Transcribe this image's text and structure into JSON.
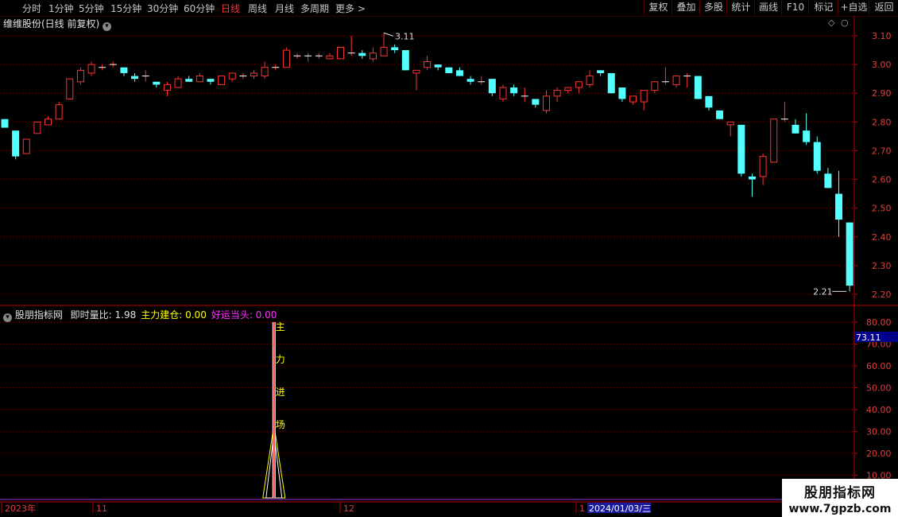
{
  "toolbar": {
    "periods": [
      "分时",
      "1分钟",
      "5分钟",
      "15分钟",
      "30分钟",
      "60分钟",
      "日线",
      "周线",
      "月线",
      "多周期",
      "更多"
    ],
    "active_period": "日线",
    "right_buttons": [
      "复权",
      "叠加",
      "多股",
      "统计",
      "画线",
      "F10",
      "标记",
      "+自选",
      "返回"
    ]
  },
  "main_chart": {
    "title": "维维股份(日线 前复权)",
    "high_annotation": "3.11",
    "low_annotation": "2.21"
  },
  "indicator": {
    "name": "股朋指标网",
    "items": [
      {
        "label": "即时量比:",
        "value": "1.98",
        "color": "#e0e0e0"
      },
      {
        "label": "主力建仓:",
        "value": "0.00",
        "color": "#ffff00"
      },
      {
        "label": "好运当头:",
        "value": "0.00",
        "color": "#ff33ff"
      }
    ],
    "marker_chars": [
      "主",
      "力",
      "进",
      "场"
    ],
    "current_value": "73.11"
  },
  "timeline": {
    "labels": [
      "2023年",
      "11",
      "12",
      "1"
    ],
    "cursor_date": "2024/01/03/三"
  },
  "watermark": {
    "line1": "股朋指标网",
    "line2": "www.7gpzb.com"
  },
  "colors": {
    "up": "#ff3232",
    "down": "#54ffff",
    "grid": "#800000",
    "axis": "#c00000"
  },
  "chart_data": {
    "type": "candlestick",
    "title": "维维股份(日线 前复权)",
    "y_axis": {
      "range": [
        2.18,
        3.12
      ],
      "ticks": [
        3.1,
        3.0,
        2.9,
        2.8,
        2.7,
        2.6,
        2.5,
        2.4,
        2.3,
        2.2
      ]
    },
    "indicator_axis": {
      "range": [
        0,
        80
      ],
      "ticks": [
        80,
        70,
        60,
        50,
        40,
        30,
        20,
        10
      ]
    },
    "ohlc": [
      [
        2.81,
        2.81,
        2.78,
        2.78
      ],
      [
        2.77,
        2.77,
        2.67,
        2.68
      ],
      [
        2.69,
        2.74,
        2.69,
        2.74
      ],
      [
        2.76,
        2.8,
        2.76,
        2.8
      ],
      [
        2.79,
        2.82,
        2.79,
        2.81
      ],
      [
        2.81,
        2.87,
        2.81,
        2.86
      ],
      [
        2.88,
        2.95,
        2.88,
        2.95
      ],
      [
        2.94,
        2.99,
        2.93,
        2.98
      ],
      [
        2.97,
        3.01,
        2.96,
        3.0
      ],
      [
        2.99,
        3.0,
        2.98,
        2.99
      ],
      [
        3.0,
        3.01,
        2.99,
        3.0
      ],
      [
        2.99,
        2.99,
        2.96,
        2.97
      ],
      [
        2.96,
        2.97,
        2.94,
        2.95
      ],
      [
        2.96,
        2.98,
        2.94,
        2.96
      ],
      [
        2.94,
        2.94,
        2.92,
        2.93
      ],
      [
        2.91,
        2.94,
        2.89,
        2.93
      ],
      [
        2.92,
        2.96,
        2.92,
        2.95
      ],
      [
        2.95,
        2.96,
        2.94,
        2.94
      ],
      [
        2.94,
        2.97,
        2.94,
        2.96
      ],
      [
        2.95,
        2.95,
        2.93,
        2.94
      ],
      [
        2.93,
        2.96,
        2.93,
        2.96
      ],
      [
        2.95,
        2.97,
        2.94,
        2.97
      ],
      [
        2.96,
        2.97,
        2.95,
        2.96
      ],
      [
        2.96,
        2.98,
        2.95,
        2.97
      ],
      [
        2.96,
        3.01,
        2.95,
        2.99
      ],
      [
        2.99,
        3.0,
        2.98,
        2.99
      ],
      [
        2.99,
        3.06,
        2.99,
        3.05
      ],
      [
        3.03,
        3.04,
        3.02,
        3.03
      ],
      [
        3.03,
        3.04,
        3.01,
        3.03
      ],
      [
        3.03,
        3.04,
        3.02,
        3.03
      ],
      [
        3.02,
        3.04,
        3.02,
        3.03
      ],
      [
        3.02,
        3.06,
        3.02,
        3.06
      ],
      [
        3.04,
        3.1,
        3.03,
        3.04
      ],
      [
        3.04,
        3.05,
        3.02,
        3.03
      ],
      [
        3.02,
        3.06,
        3.01,
        3.04
      ],
      [
        3.03,
        3.11,
        3.03,
        3.06
      ],
      [
        3.06,
        3.07,
        3.04,
        3.05
      ],
      [
        3.05,
        3.05,
        2.98,
        2.98
      ],
      [
        2.97,
        2.98,
        2.91,
        2.98
      ],
      [
        2.99,
        3.03,
        2.98,
        3.01
      ],
      [
        3.0,
        3.0,
        2.98,
        2.99
      ],
      [
        2.99,
        2.99,
        2.97,
        2.97
      ],
      [
        2.98,
        2.99,
        2.96,
        2.96
      ],
      [
        2.95,
        2.96,
        2.93,
        2.94
      ],
      [
        2.94,
        2.96,
        2.93,
        2.94
      ],
      [
        2.95,
        2.95,
        2.89,
        2.9
      ],
      [
        2.88,
        2.93,
        2.87,
        2.92
      ],
      [
        2.92,
        2.93,
        2.89,
        2.9
      ],
      [
        2.89,
        2.92,
        2.87,
        2.89
      ],
      [
        2.88,
        2.88,
        2.85,
        2.86
      ],
      [
        2.84,
        2.91,
        2.83,
        2.89
      ],
      [
        2.89,
        2.92,
        2.87,
        2.91
      ],
      [
        2.91,
        2.92,
        2.9,
        2.92
      ],
      [
        2.92,
        2.94,
        2.9,
        2.94
      ],
      [
        2.93,
        2.98,
        2.92,
        2.96
      ],
      [
        2.98,
        2.98,
        2.96,
        2.97
      ],
      [
        2.97,
        2.97,
        2.9,
        2.9
      ],
      [
        2.92,
        2.92,
        2.87,
        2.88
      ],
      [
        2.87,
        2.89,
        2.86,
        2.89
      ],
      [
        2.87,
        2.91,
        2.84,
        2.91
      ],
      [
        2.91,
        2.94,
        2.9,
        2.94
      ],
      [
        2.94,
        2.99,
        2.93,
        2.94
      ],
      [
        2.93,
        2.96,
        2.92,
        2.96
      ],
      [
        2.96,
        2.97,
        2.92,
        2.96
      ],
      [
        2.96,
        2.96,
        2.88,
        2.88
      ],
      [
        2.89,
        2.89,
        2.84,
        2.85
      ],
      [
        2.84,
        2.84,
        2.81,
        2.81
      ],
      [
        2.79,
        2.8,
        2.75,
        2.8
      ],
      [
        2.79,
        2.79,
        2.61,
        2.62
      ],
      [
        2.61,
        2.62,
        2.54,
        2.6
      ],
      [
        2.61,
        2.69,
        2.58,
        2.68
      ],
      [
        2.66,
        2.81,
        2.66,
        2.81
      ],
      [
        2.81,
        2.87,
        2.8,
        2.81
      ],
      [
        2.79,
        2.81,
        2.76,
        2.76
      ],
      [
        2.77,
        2.83,
        2.72,
        2.73
      ],
      [
        2.73,
        2.75,
        2.62,
        2.63
      ],
      [
        2.62,
        2.64,
        2.57,
        2.57
      ],
      [
        2.55,
        2.63,
        2.4,
        2.46
      ],
      [
        2.45,
        2.45,
        2.21,
        2.23
      ]
    ],
    "signal": {
      "index": 25,
      "peak": 80,
      "triangle_peak": 33
    }
  }
}
